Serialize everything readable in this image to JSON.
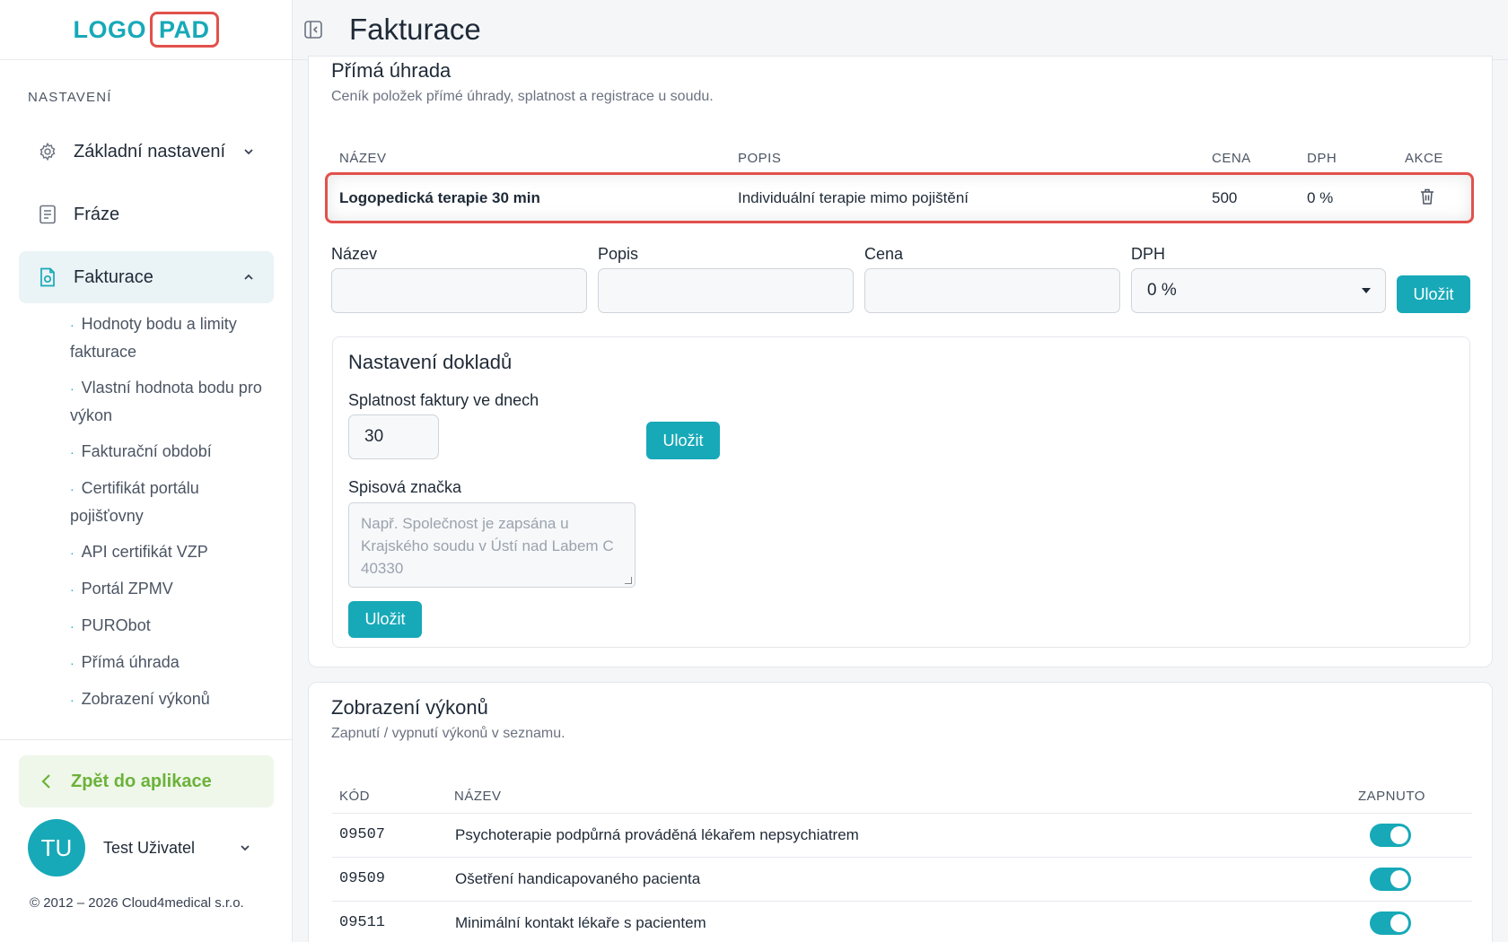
{
  "logo": {
    "part1": "LOGO",
    "part2": "PAD"
  },
  "sidebar": {
    "section_label": "NASTAVENÍ",
    "items": [
      {
        "label": "Základní nastavení",
        "icon": "gear-icon"
      },
      {
        "label": "Fráze",
        "icon": "document-icon"
      },
      {
        "label": "Fakturace",
        "icon": "invoice-icon"
      }
    ],
    "sub_items": [
      "Hodnoty bodu a limity fakturace",
      "Vlastní hodnota bodu pro výkon",
      "Fakturační období",
      "Certifikát portálu pojišťovny",
      "API certifikát VZP",
      "Portál ZPMV",
      "PURObot",
      "Přímá úhrada",
      "Zobrazení výkonů"
    ],
    "back_label": "Zpět do aplikace",
    "user": {
      "initials": "TU",
      "name": "Test Uživatel"
    },
    "copyright": "© 2012 – 2026 Cloud4medical s.r.o."
  },
  "header": {
    "title": "Fakturace"
  },
  "prima": {
    "title": "Přímá úhrada",
    "subtitle": "Ceník položek přímé úhrady, splatnost a registrace u soudu.",
    "columns": {
      "name": "NÁZEV",
      "desc": "POPIS",
      "price": "CENA",
      "vat": "DPH",
      "actions": "AKCE"
    },
    "row": {
      "name": "Logopedická terapie 30 min",
      "desc": "Individuální terapie mimo pojištění",
      "price": "500",
      "vat": "0 %"
    },
    "form": {
      "name_label": "Název",
      "desc_label": "Popis",
      "price_label": "Cena",
      "vat_label": "DPH",
      "vat_value": "0 %",
      "save": "Uložit"
    }
  },
  "doklady": {
    "title": "Nastavení dokladů",
    "due_label": "Splatnost faktury ve dnech",
    "due_value": "30",
    "save": "Uložit",
    "court_label": "Spisová značka",
    "court_placeholder": "Např. Společnost je zapsána u Krajského soudu v Ústí nad Labem C 40330",
    "save2": "Uložit"
  },
  "vykony": {
    "title": "Zobrazení výkonů",
    "subtitle": "Zapnutí / vypnutí výkonů v seznamu.",
    "columns": {
      "code": "KÓD",
      "name": "NÁZEV",
      "enabled": "ZAPNUTO"
    },
    "rows": [
      {
        "code": "09507",
        "name": "Psychoterapie podpůrná prováděná lékařem nepsychiatrem",
        "enabled": true
      },
      {
        "code": "09509",
        "name": "Ošetření handicapovaného pacienta",
        "enabled": true
      },
      {
        "code": "09511",
        "name": "Minimální kontakt lékaře s pacientem",
        "enabled": true
      }
    ]
  },
  "colors": {
    "accent": "#17a9b8",
    "highlight": "#e2514c",
    "back": "#6cb23a"
  }
}
